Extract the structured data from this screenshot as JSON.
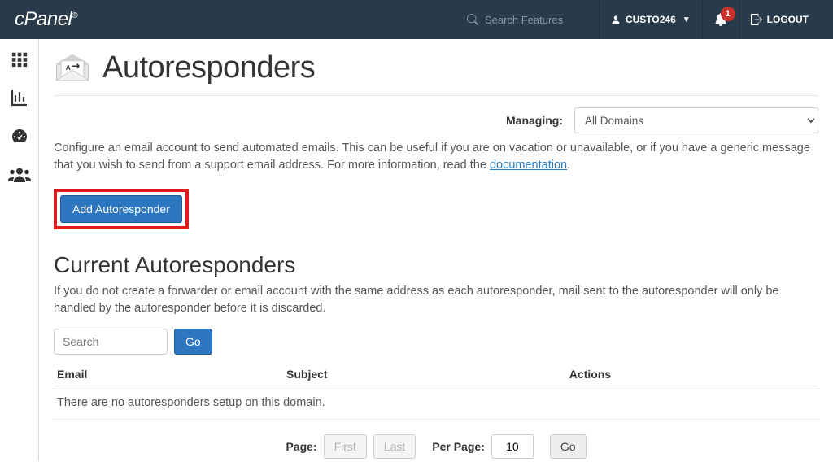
{
  "navbar": {
    "search_placeholder": "Search Features",
    "username": "CUSTO246",
    "notification_count": "1",
    "logout_label": "LOGOUT"
  },
  "page": {
    "title": "Autoresponders",
    "managing_label": "Managing:",
    "domain_selected": "All Domains",
    "intro_text_a": "Configure an email account to send automated emails. This can be useful if you are on vacation or unavailable, or if you have a generic message that you wish to send from a support email address. For more information, read the ",
    "intro_link": "documentation",
    "intro_text_b": ".",
    "add_button": "Add Autoresponder"
  },
  "section": {
    "title": "Current Autoresponders",
    "desc": "If you do not create a forwarder or email account with the same address as each autoresponder, mail sent to the autoresponder will only be handled by the autoresponder before it is discarded.",
    "search_placeholder": "Search",
    "go_label": "Go",
    "columns": {
      "email": "Email",
      "subject": "Subject",
      "actions": "Actions"
    },
    "empty_msg": "There are no autoresponders setup on this domain."
  },
  "pager": {
    "page_label": "Page:",
    "first": "First",
    "last": "Last",
    "perpage_label": "Per Page:",
    "perpage_value": "10",
    "go": "Go"
  }
}
